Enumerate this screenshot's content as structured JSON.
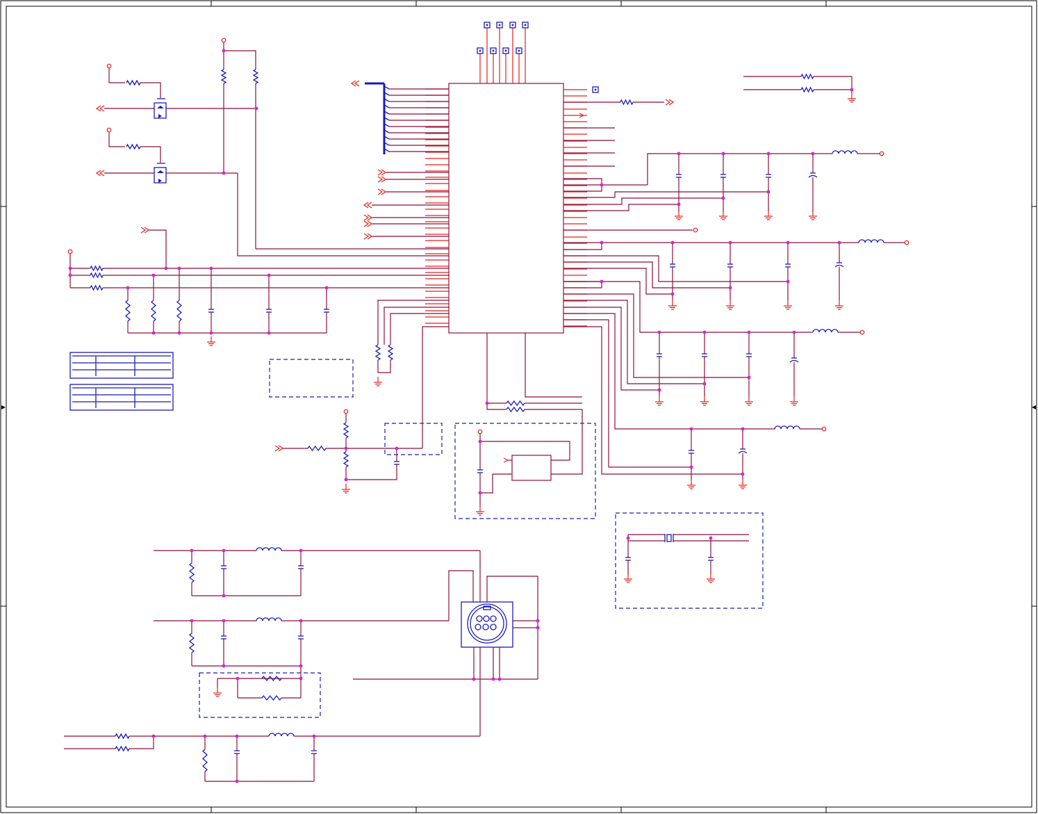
{
  "schematic": {
    "colors": {
      "wire": "#8b0f3a",
      "pin": "#e0201e",
      "component": "#1a1ab8",
      "junction": "#d81fd8",
      "frame": "#000000"
    },
    "text_labels": [],
    "blocks": [
      "mosfet-switch-top",
      "mosfet-switch-bottom",
      "main-ic",
      "filter-block-1",
      "filter-block-2",
      "filter-block-3",
      "filter-block-4",
      "crystal-oscillator",
      "regulator-subcircuit",
      "mini-din-connector",
      "video-filter-1",
      "video-filter-2",
      "video-filter-3",
      "title-table-1",
      "title-table-2"
    ]
  }
}
